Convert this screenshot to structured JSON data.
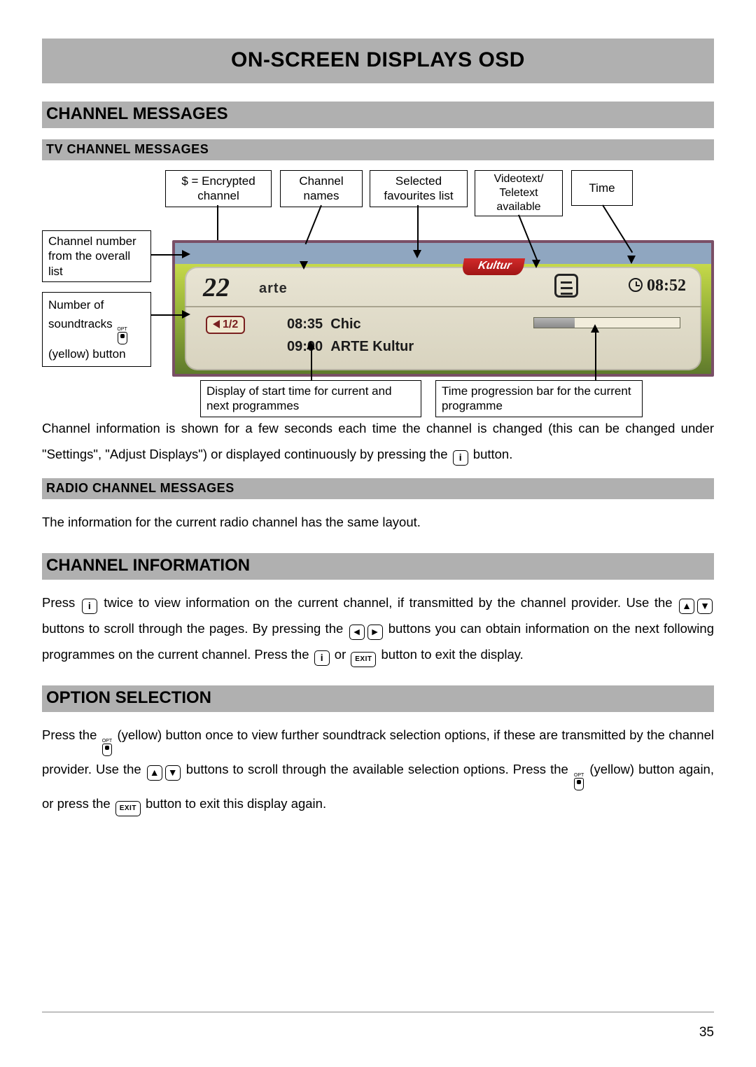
{
  "page": {
    "title": "ON-SCREEN DISPLAYS OSD",
    "number": "35"
  },
  "sections": {
    "channel_messages": "CHANNEL MESSAGES",
    "tv_channel_messages": "TV CHANNEL MESSAGES",
    "radio_channel_messages": "RADIO CHANNEL MESSAGES",
    "channel_information": "CHANNEL INFORMATION",
    "option_selection": "OPTION SELECTION"
  },
  "diagram": {
    "labels": {
      "encrypted": "$ = Encrypted channel",
      "channel_names": "Channel names",
      "favourites": "Selected favourites list",
      "teletext": "Videotext/ Teletext available",
      "time": "Time",
      "channel_number": "Channel number from the overall list",
      "soundtracks_pre": "Number of soundtracks ",
      "soundtracks_post": " (yellow) button",
      "start_time": "Display of start time for current and next programmes",
      "progress": "Time progression bar for the current programme"
    },
    "osd": {
      "channel_number": "22",
      "channel_name": "arte",
      "favourite": "Kultur",
      "time": "08:52",
      "soundtrack": "1/2",
      "prog1_time": "08:35",
      "prog1_name": "Chic",
      "prog2_time": "09:00",
      "prog2_name": "ARTE Kultur"
    }
  },
  "body": {
    "p1a": "Channel information is shown for a few seconds each time the channel is changed (this can be changed under \"Settings\", \"Adjust Displays\") or displayed continuously by pressing the ",
    "p1b": " button.",
    "radio": "The information for the current radio channel has the same layout.",
    "ci_a": "Press ",
    "ci_b": " twice to view information on the current channel, if transmitted by the channel provider. Use the ",
    "ci_c": " buttons to scroll through the pages. By pressing the ",
    "ci_d": " buttons you can obtain information on the next following programmes on the current channel. Press the ",
    "ci_e": " or ",
    "ci_f": " button to exit the display.",
    "os_a": "Press the ",
    "os_b": " (yellow) button once to view further soundtrack selection options, if these are transmitted by the channel provider. Use the ",
    "os_c": " buttons to scroll through the available selection options. Press the ",
    "os_d": " (yellow) button again, or press the ",
    "os_e": " button to exit this display again."
  },
  "buttons": {
    "info": "i",
    "up": "▲",
    "down": "▼",
    "left": "◄",
    "right": "►",
    "exit": "EXIT",
    "opt": "OPT"
  }
}
